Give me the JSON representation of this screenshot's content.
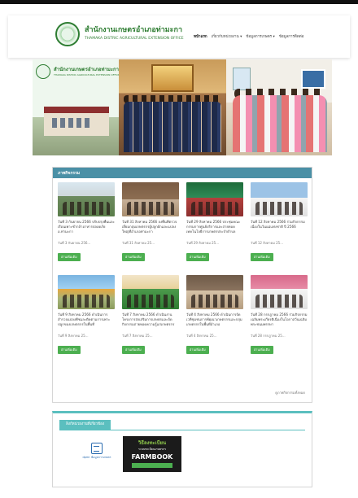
{
  "site": {
    "title": "สำนักงานเกษตรอำเภอท่ามะกา",
    "subtitle": "THAMAKA DISTRIC AGRICULTURAL EXTENSION OFFICE"
  },
  "nav": {
    "items": [
      "หน้าแรก",
      "เกี่ยวกับหน่วยงาน ▾",
      "ข้อมูลการเกษตร ▾",
      "ข้อมูลการติดต่อ"
    ]
  },
  "banner": {
    "logo_title": "สำนักงานเกษตรอำเภอท่ามะกา",
    "logo_subtitle": "THAMAKA DISTRIC AGRICULTURAL EXTENSION OFFICE"
  },
  "news": {
    "heading": "ภาพกิจกรรม",
    "more_label": "อ่านเพิ่มเติม",
    "see_all": "ดูภาพกิจกรรมทั้งหมด",
    "items": [
      {
        "text": "วันที่ 3 กันยายน 2566 ปรับปรุงพื้นและเรือนเพาะชำกล้าอาหารปลอดภัย อ.ท่ามะกา",
        "date": "วันที่ 3 กันยายน 256..."
      },
      {
        "text": "วันที่ 31 สิงหาคม 2566 ลงพื้นที่ตรวจเยี่ยมกลุ่มเกษตรกรผู้ปลูกผักและแปลงใหญ่ที่อำเภอท่ามะกา",
        "date": "วันที่ 31 สิงหาคม 25..."
      },
      {
        "text": "วันที่ 29 สิงหาคม 2566 ประชุมคณะกรรมการศูนย์บริการและถ่ายทอดเทคโนโลยีการเกษตรประจำตำบล",
        "date": "วันที่ 29 สิงหาคม 25..."
      },
      {
        "text": "วันที่ 12 สิงหาคม 2566 ร่วมกิจกรรมเนื่องในวันแม่แห่งชาติ ปี 2566",
        "date": "วันที่ 12 สิงหาคม 25..."
      },
      {
        "text": "วันที่ 9 สิงหาคม 2566 ดำเนินการสำรวจแปลงพืชและติดตามการเพาะปลูกของเกษตรกรในพื้นที่",
        "date": "วันที่ 9 สิงหาคม 25..."
      },
      {
        "text": "วันที่ 7 สิงหาคม 2566 ดำเนินงานโครงการส่งเสริมการเกษตรและจัดกิจกรรมถ่ายทอดความรู้แก่เกษตรกร",
        "date": "วันที่ 7 สิงหาคม 25..."
      },
      {
        "text": "วันที่ 4 สิงหาคม 2566 ดำเนินการจัดเวทีชุมชนการพัฒนาเกษตรกรและกลุ่มเกษตรกรในพื้นที่อำเภอ",
        "date": "วันที่ 4 สิงหาคม 25..."
      },
      {
        "text": "วันที่ 28 กรกฎาคม 2566 ร่วมกิจกรรมเฉลิมพระเกียรติเนื่องในโอกาสวันเฉลิมพระชนมพรรษา",
        "date": "วันที่ 28 กรกฎาคม 25..."
      }
    ]
  },
  "links": {
    "tab_label": "ลิงก์หน่วยงานที่เกี่ยวข้อง",
    "doc_label": "dpmr\nข้อมูลการเกษตร",
    "farmbook_line1": "วิธีลงทะเบียน",
    "farmbook_line2": "ระบบทะเบียนเกษตรกร",
    "farmbook_line3": "FARMBOOK"
  }
}
